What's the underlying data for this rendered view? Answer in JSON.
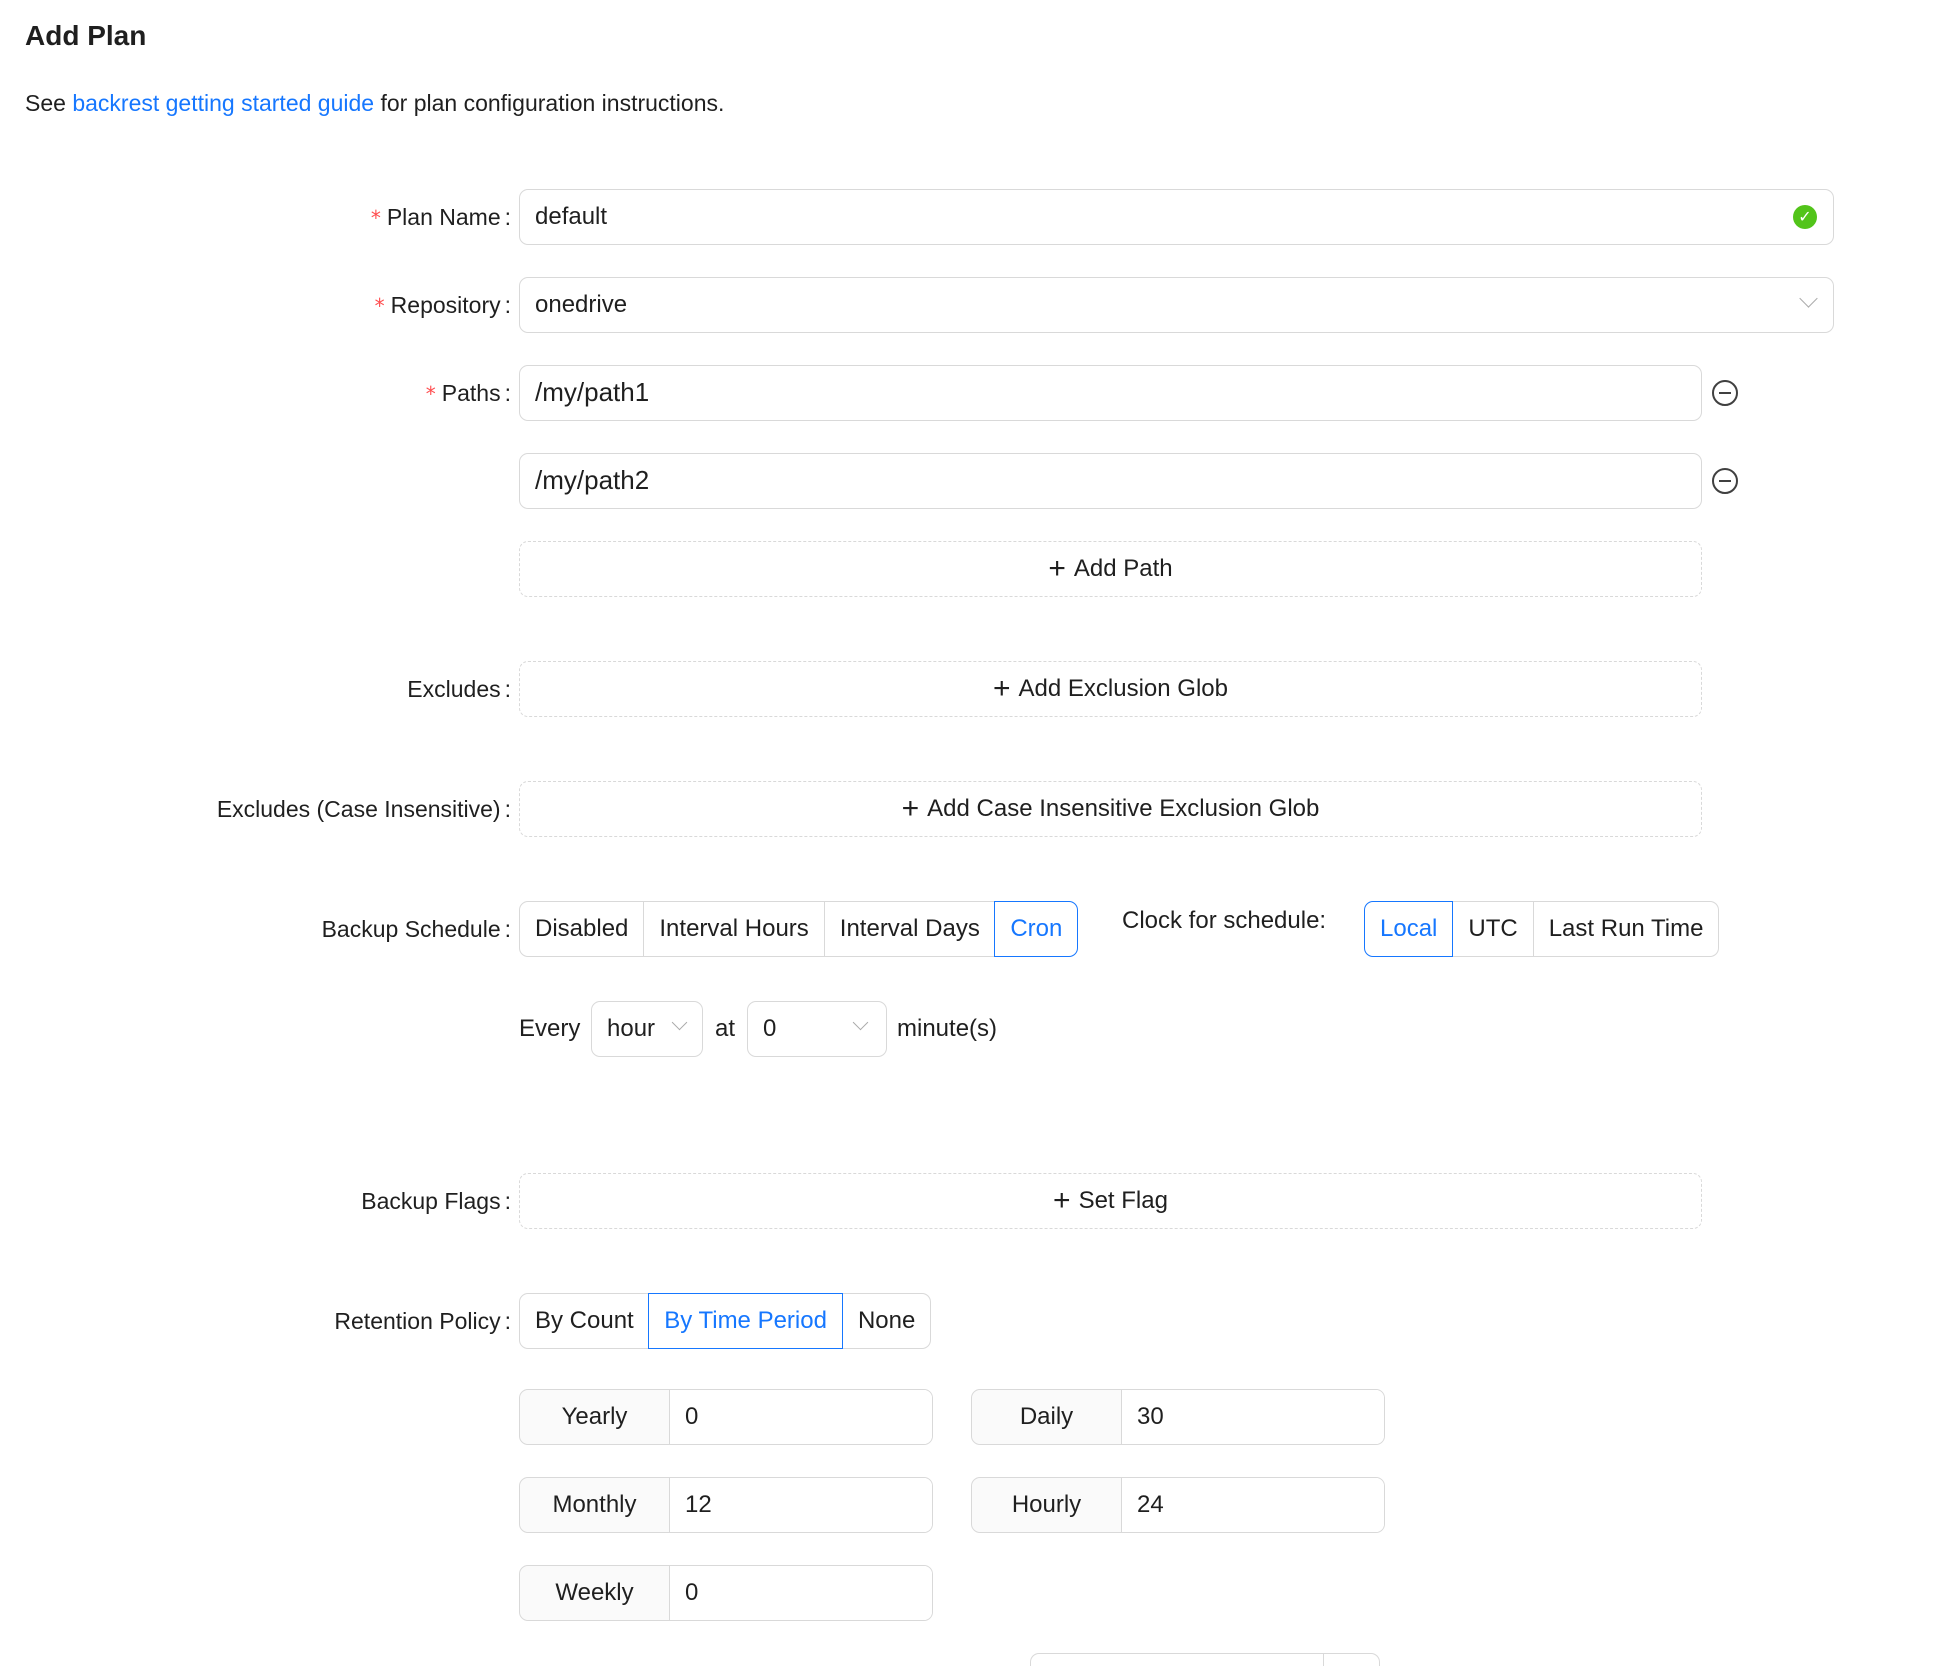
{
  "page": {
    "title": "Add Plan",
    "intro_prefix": "See ",
    "intro_link": "backrest getting started guide",
    "intro_suffix": " for plan configuration instructions."
  },
  "form": {
    "plan_name": {
      "label": "Plan Name",
      "value": "default",
      "required": true
    },
    "repository": {
      "label": "Repository",
      "value": "onedrive",
      "required": true
    },
    "paths": {
      "label": "Paths",
      "required": true,
      "values": [
        "/my/path1",
        "/my/path2"
      ],
      "add_label": "Add Path"
    },
    "excludes": {
      "label": "Excludes",
      "add_label": "Add Exclusion Glob"
    },
    "iexcludes": {
      "label": "Excludes (Case Insensitive)",
      "add_label": "Add Case Insensitive Exclusion Glob"
    },
    "schedule": {
      "label": "Backup Schedule",
      "options": [
        "Disabled",
        "Interval Hours",
        "Interval Days",
        "Cron"
      ],
      "selected": "Cron",
      "clock_label": "Clock for schedule:",
      "clock_options": [
        "Local",
        "UTC",
        "Last Run Time"
      ],
      "clock_selected": "Local",
      "every_label": "Every",
      "every_value": "hour",
      "at_label": "at",
      "minute_value": "0",
      "minute_suffix": "minute(s)"
    },
    "flags": {
      "label": "Backup Flags",
      "add_label": "Set Flag"
    },
    "retention": {
      "label": "Retention Policy",
      "options": [
        "By Count",
        "By Time Period",
        "None"
      ],
      "selected": "By Time Period",
      "yearly": {
        "label": "Yearly",
        "value": "0"
      },
      "monthly": {
        "label": "Monthly",
        "value": "12"
      },
      "weekly": {
        "label": "Weekly",
        "value": "0"
      },
      "daily": {
        "label": "Daily",
        "value": "30"
      },
      "hourly": {
        "label": "Hourly",
        "value": "24"
      }
    }
  },
  "colors": {
    "accent": "#1677ff",
    "required": "#ff4d4f",
    "success": "#52c41a",
    "border": "#d9d9d9"
  },
  "icons": {
    "valid": "check-circle-icon",
    "dropdown": "chevron-down-icon",
    "remove": "minus-circle-icon",
    "add": "plus-icon"
  }
}
